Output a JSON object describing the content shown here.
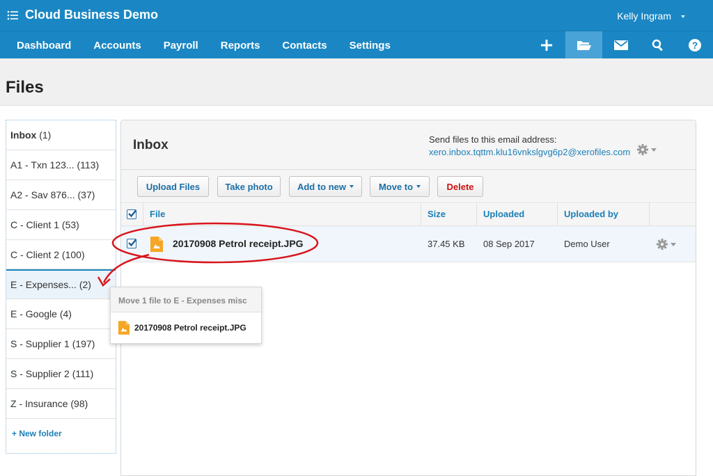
{
  "header": {
    "org_name": "Cloud Business Demo",
    "user_name": "Kelly Ingram",
    "nav": [
      "Dashboard",
      "Accounts",
      "Payroll",
      "Reports",
      "Contacts",
      "Settings"
    ],
    "icons": [
      "plus-icon",
      "folder-open-icon",
      "mail-icon",
      "search-icon",
      "help-icon"
    ],
    "active_icon": "folder-open-icon",
    "accent_color": "#1a87c4"
  },
  "page": {
    "title": "Files"
  },
  "folders": [
    {
      "name": "Inbox",
      "count": "(1)"
    },
    {
      "name": "A1 - Txn 123...",
      "count": "(113)"
    },
    {
      "name": "A2 - Sav 876...",
      "count": "(37)"
    },
    {
      "name": "C - Client 1",
      "count": "(53)"
    },
    {
      "name": "C - Client 2",
      "count": "(100)"
    },
    {
      "name": "E - Expenses...",
      "count": "(2)"
    },
    {
      "name": "E - Google",
      "count": "(4)"
    },
    {
      "name": "S - Supplier 1",
      "count": "(197)"
    },
    {
      "name": "S - Supplier 2",
      "count": "(111)"
    },
    {
      "name": "Z - Insurance",
      "count": "(98)"
    }
  ],
  "new_folder_label": "+ New folder",
  "panel": {
    "title": "Inbox",
    "send_label": "Send files to this email address:",
    "send_email": "xero.inbox.tqttm.klu16vnkslgvg6p2@xerofiles.com"
  },
  "toolbar": {
    "upload": "Upload Files",
    "take_photo": "Take photo",
    "add_to_new": "Add to new",
    "move_to": "Move to",
    "delete": "Delete"
  },
  "table": {
    "headers": [
      "File",
      "Size",
      "Uploaded",
      "Uploaded by"
    ],
    "rows": [
      {
        "file": "20170908 Petrol receipt.JPG",
        "size": "37.45 KB",
        "uploaded": "08 Sep 2017",
        "uploaded_by": "Demo User",
        "checked": true
      }
    ]
  },
  "drag_tooltip": {
    "title": "Move 1 file to E - Expenses misc",
    "file": "20170908 Petrol receipt.JPG"
  },
  "annotation_color": "#d9141c"
}
